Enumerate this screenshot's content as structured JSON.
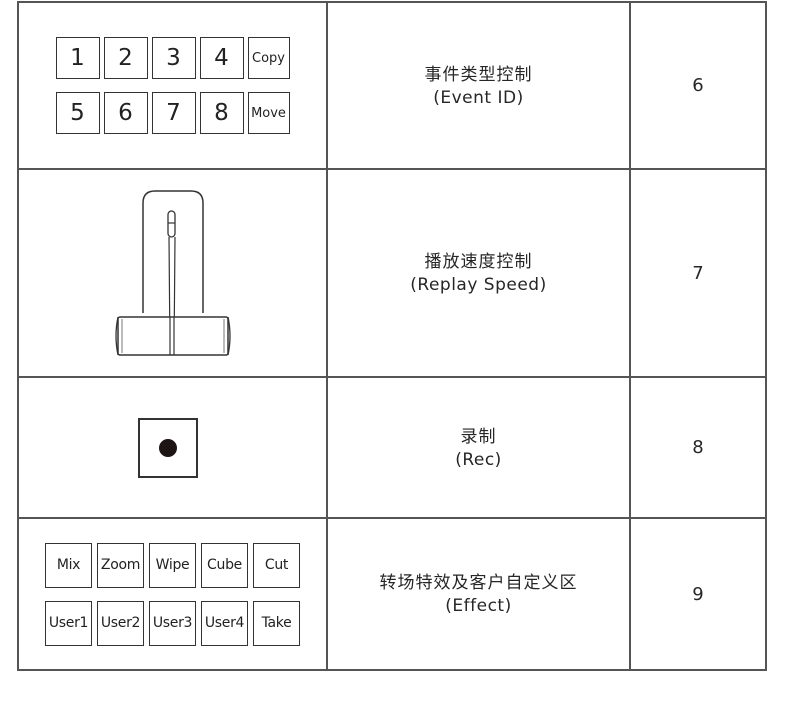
{
  "rows": [
    {
      "illustration": "event-id-keypad",
      "keys": [
        "1",
        "2",
        "3",
        "4",
        "Copy",
        "5",
        "6",
        "7",
        "8",
        "Move"
      ],
      "desc_zh": "事件类型控制",
      "desc_en": "(Event ID)",
      "number": "6"
    },
    {
      "illustration": "t-bar-lever",
      "desc_zh": "播放速度控制",
      "desc_en": "(Replay Speed)",
      "number": "7"
    },
    {
      "illustration": "record-button",
      "icon": "record-dot",
      "desc_zh": "录制",
      "desc_en": "(Rec)",
      "number": "8"
    },
    {
      "illustration": "effect-keypad",
      "keys": [
        "Mix",
        "Zoom",
        "Wipe",
        "Cube",
        "Cut",
        "User1",
        "User2",
        "User3",
        "User4",
        "Take"
      ],
      "desc_zh": "转场特效及客户自定义区",
      "desc_en": "(Effect)",
      "number": "9"
    }
  ]
}
